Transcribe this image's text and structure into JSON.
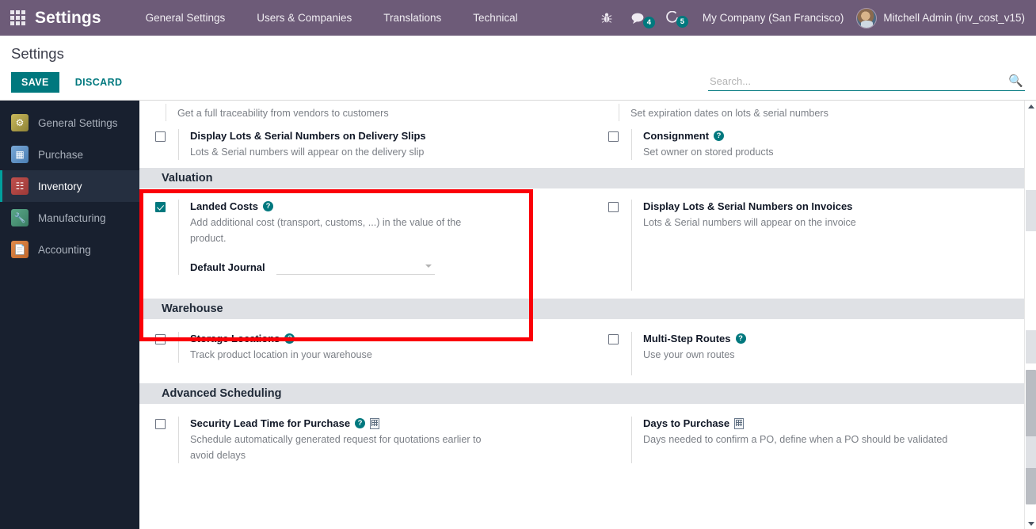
{
  "topbar": {
    "apps_icon": "apps-grid-icon",
    "brand": "Settings",
    "menu": [
      {
        "label": "General Settings"
      },
      {
        "label": "Users & Companies"
      },
      {
        "label": "Translations"
      },
      {
        "label": "Technical"
      }
    ],
    "debug_icon": "bug-icon",
    "messages_icon": "chat-bubble-icon",
    "messages_count": "4",
    "activities_icon": "clock-icon",
    "activities_count": "5",
    "company": "My Company (San Francisco)",
    "user": "Mitchell Admin (inv_cost_v15)",
    "accent": "#6d5b78"
  },
  "control_panel": {
    "title": "Settings",
    "save_label": "SAVE",
    "discard_label": "DISCARD",
    "search_placeholder": "Search...",
    "search_value": "",
    "search_icon": "search-icon",
    "accent": "#00787e"
  },
  "sidebar": {
    "items": [
      {
        "label": "General Settings",
        "icon": "gear-icon",
        "active": false
      },
      {
        "label": "Purchase",
        "icon": "credit-card-icon",
        "active": false
      },
      {
        "label": "Inventory",
        "icon": "inventory-box-icon",
        "active": true
      },
      {
        "label": "Manufacturing",
        "icon": "wrench-icon",
        "active": false
      },
      {
        "label": "Accounting",
        "icon": "invoice-icon",
        "active": false
      }
    ]
  },
  "settings": {
    "partial_top": {
      "left_desc": "Get a full traceability from vendors to customers",
      "right_desc": "Set expiration dates on lots & serial numbers"
    },
    "traceability_row": {
      "left": {
        "checked": false,
        "title": "Display Lots & Serial Numbers on Delivery Slips",
        "desc": "Lots & Serial numbers will appear on the delivery slip",
        "has_help": false
      },
      "right": {
        "checked": false,
        "title": "Consignment",
        "desc": "Set owner on stored products",
        "has_help": true
      }
    },
    "sections": [
      {
        "name": "Valuation",
        "highlighted": true,
        "left": {
          "checked": true,
          "title": "Landed Costs",
          "desc": "Add additional cost (transport, customs, ...) in the value of the product.",
          "has_help": true,
          "field": {
            "label": "Default Journal",
            "value": "",
            "caret": "chevron-down-icon"
          }
        },
        "right": {
          "checked": false,
          "title": "Display Lots & Serial Numbers on Invoices",
          "desc": "Lots & Serial numbers will appear on the invoice",
          "has_help": false
        }
      },
      {
        "name": "Warehouse",
        "highlighted": false,
        "left": {
          "checked": false,
          "title": "Storage Locations",
          "desc": "Track product location in your warehouse",
          "has_help": true
        },
        "right": {
          "checked": false,
          "title": "Multi-Step Routes",
          "desc": "Use your own routes",
          "has_help": true
        }
      },
      {
        "name": "Advanced Scheduling",
        "highlighted": false,
        "left": {
          "checked": false,
          "title": "Security Lead Time for Purchase",
          "desc": "Schedule automatically generated request for quotations earlier to avoid delays",
          "has_help": true,
          "has_company_icon": true
        },
        "right": {
          "checked": null,
          "title": "Days to Purchase",
          "desc": "Days needed to confirm a PO, define when a PO should be validated",
          "has_help": false,
          "has_company_icon": true
        }
      }
    ]
  },
  "scrollbar": {
    "up_icon": "scroll-up-arrow-icon",
    "down_icon": "scroll-down-arrow-icon",
    "thumb": "scrollbar-thumb"
  }
}
